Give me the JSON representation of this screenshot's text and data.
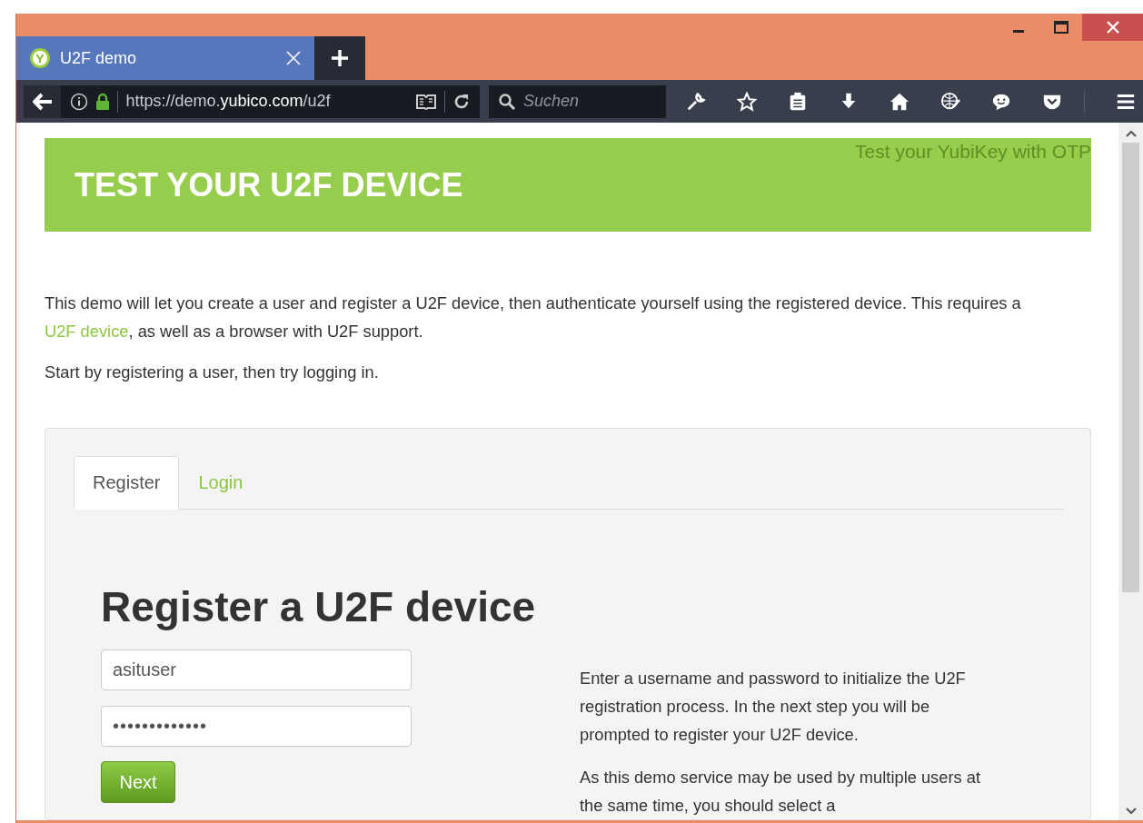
{
  "browser": {
    "tabs": [
      {
        "title": "U2F demo",
        "selected": true
      }
    ],
    "address": "https://demo.**yubico.com**/u2f",
    "search": {
      "placeholder": "Suchen"
    }
  },
  "page": {
    "banner": {
      "title": "TEST YOUR U2F DEVICE",
      "link": "Test your YubiKey with OTP"
    },
    "intro": {
      "before": "This demo will let you create a user and register a U2F device, then authenticate yourself using the registered device. This requires a ",
      "link": "U2F device",
      "after": ", as well as a browser with U2F support."
    },
    "hint": "Start by registering a user, then try logging in.",
    "tabs": [
      {
        "label": "Register",
        "selected": true
      },
      {
        "label": "Login",
        "selected": false
      }
    ],
    "heading": "Register a U2F device",
    "username": "asituser",
    "password": "•••••••••••••",
    "button": "Next",
    "help": [
      "Enter a username and password to initialize the U2F registration process. In the next step you will be prompted to register your U2F device.",
      "As this demo service may be used by multiple users at the same time, you should select a"
    ]
  }
}
